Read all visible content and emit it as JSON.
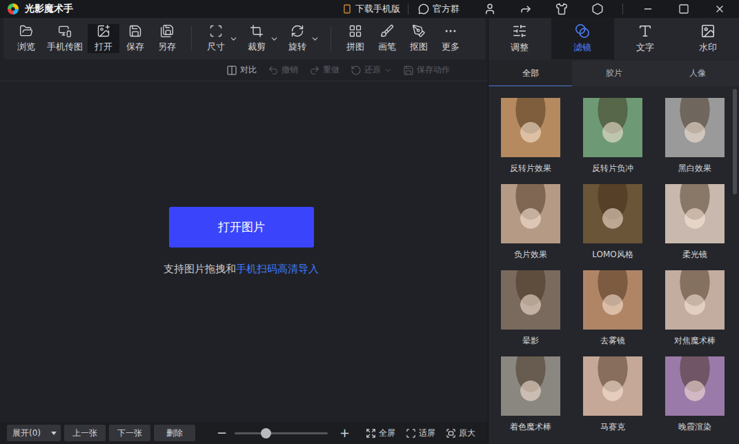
{
  "app": {
    "title": "光影魔术手",
    "download": "下载手机版",
    "group": "官方群"
  },
  "toolbar": [
    [
      {
        "label": "浏览",
        "selected": false,
        "dropdown": false
      },
      {
        "label": "手机传图",
        "selected": false,
        "dropdown": false
      },
      {
        "label": "打开",
        "selected": true,
        "dropdown": false
      },
      {
        "label": "保存",
        "selected": false,
        "dropdown": false
      },
      {
        "label": "另存",
        "selected": false,
        "dropdown": false
      }
    ],
    [
      {
        "label": "尺寸",
        "selected": false,
        "dropdown": true
      },
      {
        "label": "裁剪",
        "selected": false,
        "dropdown": true
      },
      {
        "label": "旋转",
        "selected": false,
        "dropdown": true
      }
    ],
    [
      {
        "label": "拼图",
        "selected": false,
        "dropdown": false
      },
      {
        "label": "画笔",
        "selected": false,
        "dropdown": false
      },
      {
        "label": "抠图",
        "selected": false,
        "dropdown": false
      },
      {
        "label": "更多",
        "selected": false,
        "dropdown": false
      }
    ]
  ],
  "actions": [
    {
      "label": "对比",
      "disabled": false,
      "dropdown": false
    },
    {
      "label": "撤销",
      "disabled": true,
      "dropdown": false
    },
    {
      "label": "重做",
      "disabled": true,
      "dropdown": false
    },
    {
      "label": "还原",
      "disabled": true,
      "dropdown": true
    },
    {
      "label": "保存动作",
      "disabled": true,
      "dropdown": false
    }
  ],
  "canvas": {
    "button": "打开图片",
    "hint": "支持图片拖拽和",
    "link": "手机扫码高清导入"
  },
  "footer": {
    "expand": "展开(0)",
    "buttons": [
      "上一张",
      "下一张",
      "删除"
    ],
    "zoom": {
      "minus": "−",
      "plus": "+",
      "level": 0.33
    },
    "views": [
      "全屏",
      "适屏",
      "原大"
    ]
  },
  "panel": {
    "tabs": [
      {
        "label": "调整",
        "selected": false
      },
      {
        "label": "滤镜",
        "selected": true
      },
      {
        "label": "文字",
        "selected": false
      },
      {
        "label": "水印",
        "selected": false
      }
    ],
    "subtabs": [
      {
        "label": "全部",
        "selected": true
      },
      {
        "label": "胶片",
        "selected": false
      },
      {
        "label": "人像",
        "selected": false
      }
    ],
    "scrollbar": {
      "level": 0.3
    },
    "filters": [
      {
        "name": "反转片效果",
        "color": "#b58a5e"
      },
      {
        "name": "反转片负冲",
        "color": "#6d9a74"
      },
      {
        "name": "黑白效果",
        "color": "#9a9a9a"
      },
      {
        "name": "负片效果",
        "color": "#b59a86"
      },
      {
        "name": "LOMO风格",
        "color": "#6b5538"
      },
      {
        "name": "柔光镜",
        "color": "#c8b8ad"
      },
      {
        "name": "晕影",
        "color": "#7a6a5e"
      },
      {
        "name": "去雾镜",
        "color": "#b08566"
      },
      {
        "name": "对焦魔术棒",
        "color": "#c2ada0"
      },
      {
        "name": "着色魔术棒",
        "color": "#8a8680"
      },
      {
        "name": "马赛克",
        "color": "#c6a898"
      },
      {
        "name": "晚霞渲染",
        "color": "#9a7aa8"
      }
    ]
  }
}
